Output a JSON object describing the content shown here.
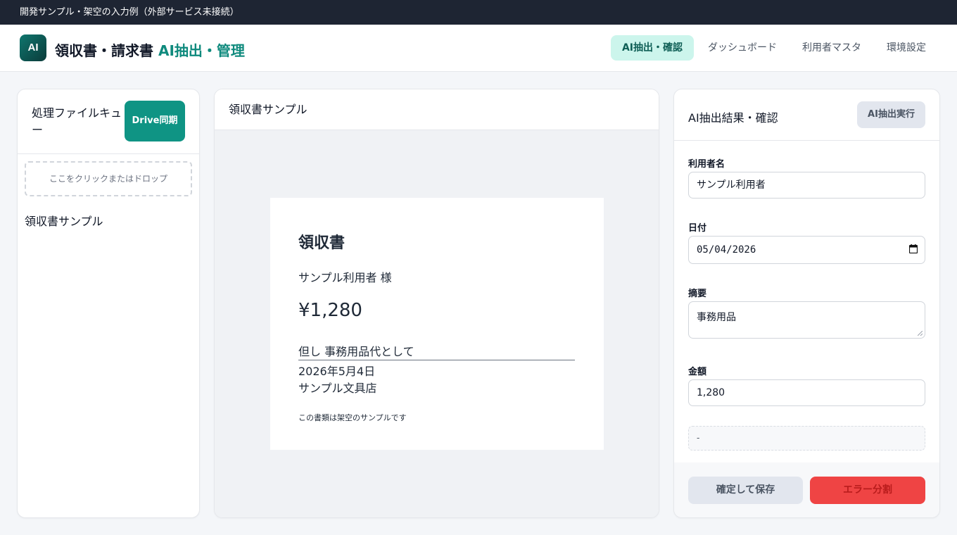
{
  "banner": "開発サンプル・架空の入力例（外部サービス未接続）",
  "header": {
    "logo_text": "AI",
    "title_main": "領収書・請求書 ",
    "title_accent": "AI抽出・管理",
    "nav": [
      {
        "label": "AI抽出・確認",
        "active": true
      },
      {
        "label": "ダッシュボード",
        "active": false
      },
      {
        "label": "利用者マスタ",
        "active": false
      },
      {
        "label": "環境設定",
        "active": false
      }
    ]
  },
  "queue": {
    "title": "処理ファイルキュー",
    "sync_label": "Drive同期",
    "dropzone_text": "ここをクリックまたはドロップ",
    "files": [
      "領収書サンプル"
    ]
  },
  "preview": {
    "title": "領収書サンプル",
    "receipt": {
      "heading": "領収書",
      "recipient": "サンプル利用者 様",
      "amount": "¥1,280",
      "description": "但し 事務用品代として",
      "date": "2026年5月4日",
      "issuer": "サンプル文具店",
      "note": "この書類は架空のサンプルです"
    }
  },
  "extraction": {
    "title": "AI抽出結果・確認",
    "run_label": "AI抽出実行",
    "fields": {
      "user_label": "利用者名",
      "user_value": "サンプル利用者",
      "date_label": "日付",
      "date_value": "05/04/2026",
      "summary_label": "摘要",
      "summary_value": "事務用品",
      "amount_label": "金額",
      "amount_value": "1,280"
    },
    "status": "-",
    "save_label": "確定して保存",
    "error_label": "エラー分割"
  }
}
